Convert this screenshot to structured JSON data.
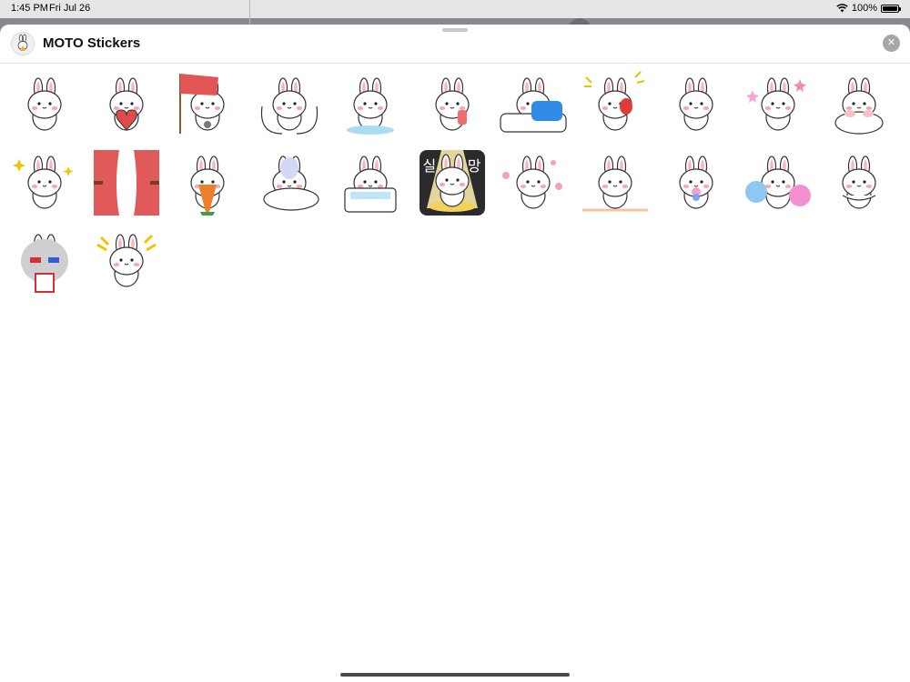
{
  "status_bar": {
    "time": "1:45 PM",
    "date": "Fri Jul 26",
    "battery": "100%",
    "battery_level": 1.0
  },
  "sheet": {
    "title": "MOTO Stickers",
    "close_icon": "close-icon"
  },
  "sticker_overlays": {
    "left_char": "실",
    "right_char": "망"
  },
  "stickers": [
    {
      "id": "bunny-laughing-hand-to-mouth"
    },
    {
      "id": "bunny-holding-red-heart"
    },
    {
      "id": "bunny-red-flag-microphone"
    },
    {
      "id": "bunny-big-hug-arms"
    },
    {
      "id": "bunny-crying-puddle"
    },
    {
      "id": "bunny-crying-holding-paper"
    },
    {
      "id": "bunny-blue-pillow-bed"
    },
    {
      "id": "bunny-boxing-glove"
    },
    {
      "id": "bunny-standing-smile"
    },
    {
      "id": "bunny-stars-sitting"
    },
    {
      "id": "bunny-peeking-blush"
    },
    {
      "id": "bunny-sparkles-pointing"
    },
    {
      "id": "red-curtains-stage"
    },
    {
      "id": "bunny-carrot-costume"
    },
    {
      "id": "bunny-ghost-lying-down"
    },
    {
      "id": "bunny-bathtub"
    },
    {
      "id": "bunny-spotlight-disappointed"
    },
    {
      "id": "bunny-flowers-around"
    },
    {
      "id": "bunny-sitting-on-floor"
    },
    {
      "id": "bunny-pacifier"
    },
    {
      "id": "bunny-pom-poms"
    },
    {
      "id": "bunny-arms-crossed"
    },
    {
      "id": "bunny-3d-glasses-popcorn"
    },
    {
      "id": "bunny-excited-clapping"
    }
  ]
}
